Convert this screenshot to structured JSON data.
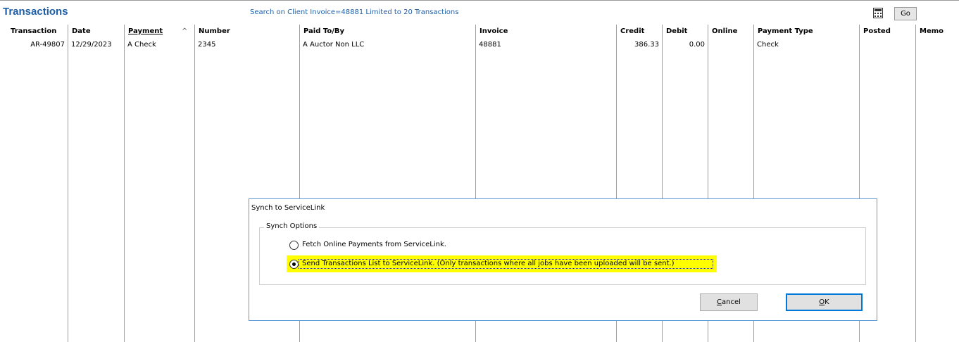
{
  "header": {
    "title": "Transactions",
    "search_info": "Search on Client Invoice=48881 Limited to 20 Transactions",
    "go_label": "Go"
  },
  "table": {
    "columns": [
      "Transaction",
      "Date",
      "Payment",
      "Number",
      "Paid To/By",
      "Invoice",
      "Credit",
      "Debit",
      "Online",
      "Payment Type",
      "Posted",
      "Memo"
    ],
    "sorted_column": "Payment",
    "rows": [
      [
        "AR-49807",
        "12/29/2023",
        "A Check",
        "2345",
        "A Auctor Non LLC",
        "48881",
        "386.33",
        "0.00",
        "",
        "Check",
        "",
        ""
      ]
    ]
  },
  "dialog": {
    "title": "Synch to ServiceLink",
    "group_label": "Synch Options",
    "options": [
      {
        "label": "Fetch Online Payments from ServiceLink.",
        "selected": false
      },
      {
        "label": "Send Transactions List to ServiceLink.  (Only transactions where all jobs have been uploaded will be sent.)",
        "selected": true
      }
    ],
    "cancel_mnemonic": "C",
    "cancel_rest": "ancel",
    "ok_mnemonic": "O",
    "ok_rest": "K"
  },
  "colors": {
    "title_blue": "#1f5fa8",
    "highlight": "#ffff00",
    "dialog_border": "#5b9bd5"
  },
  "icons": {
    "calculator": "calculator-icon",
    "sort": "sort-ascending-icon"
  }
}
